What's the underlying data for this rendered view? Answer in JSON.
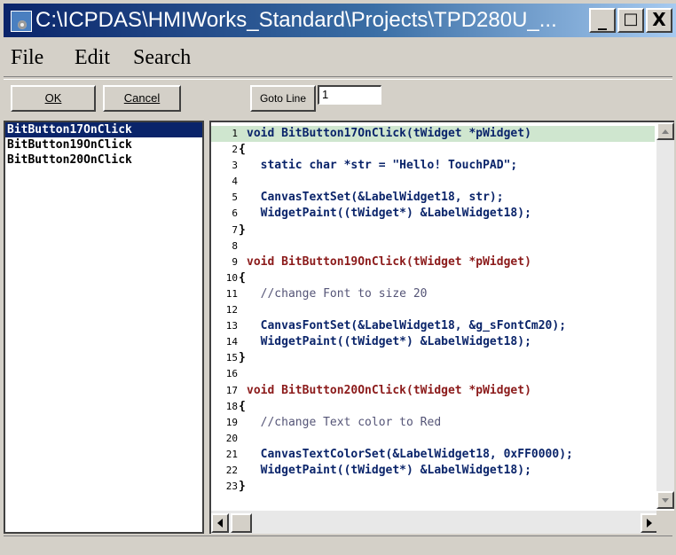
{
  "window": {
    "title": "C:\\ICPDAS\\HMIWorks_Standard\\Projects\\TPD280U_..."
  },
  "controls": {
    "minimize": "_",
    "maximize": "□",
    "close": "X"
  },
  "menu": [
    "File",
    "Edit",
    "Search"
  ],
  "toolbar": {
    "ok_label": "OK",
    "cancel_label": "Cancel",
    "goto_label": "Goto Line",
    "goto_value": "1"
  },
  "functions": [
    "BitButton17OnClick",
    "BitButton19OnClick",
    "BitButton20OnClick"
  ],
  "code_lines": [
    {
      "n": "1",
      "text": "void BitButton17OnClick(tWidget *pWidget)",
      "fold": ""
    },
    {
      "n": "2",
      "text": "{",
      "fold": ""
    },
    {
      "n": "3",
      "text": "  static char *str = \"Hello! TouchPAD\";",
      "fold": ""
    },
    {
      "n": "4",
      "text": "",
      "fold": ""
    },
    {
      "n": "5",
      "text": "  CanvasTextSet(&LabelWidget18, str);",
      "fold": ""
    },
    {
      "n": "6",
      "text": "  WidgetPaint((tWidget*) &LabelWidget18);",
      "fold": ""
    },
    {
      "n": "7",
      "text": "}",
      "fold": ""
    },
    {
      "n": "8",
      "text": "",
      "fold": ""
    },
    {
      "n": "9",
      "text": "void BitButton19OnClick(tWidget *pWidget)",
      "fold": ""
    },
    {
      "n": "10",
      "text": "{",
      "fold": ""
    },
    {
      "n": "11",
      "text": "  //change Font to size 20",
      "fold": ""
    },
    {
      "n": "12",
      "text": "",
      "fold": ""
    },
    {
      "n": "13",
      "text": "  CanvasFontSet(&LabelWidget18, &g_sFontCm20);",
      "fold": ""
    },
    {
      "n": "14",
      "text": "  WidgetPaint((tWidget*) &LabelWidget18);",
      "fold": ""
    },
    {
      "n": "15",
      "text": "}",
      "fold": ""
    },
    {
      "n": "16",
      "text": "",
      "fold": ""
    },
    {
      "n": "17",
      "text": "void BitButton20OnClick(tWidget *pWidget)",
      "fold": ""
    },
    {
      "n": "18",
      "text": "{",
      "fold": ""
    },
    {
      "n": "19",
      "text": "  //change Text color to Red",
      "fold": ""
    },
    {
      "n": "20",
      "text": "",
      "fold": ""
    },
    {
      "n": "21",
      "text": "  CanvasTextColorSet(&LabelWidget18, 0xFF0000);",
      "fold": ""
    },
    {
      "n": "22",
      "text": "  WidgetPaint((tWidget*) &LabelWidget18);",
      "fold": ""
    },
    {
      "n": "23",
      "text": "}",
      "fold": ""
    }
  ],
  "colors": {
    "highlight_line": "#cfe6cf",
    "selection": "#0a246a",
    "keyword": "#8b1a1a",
    "code": "#0a246a"
  }
}
